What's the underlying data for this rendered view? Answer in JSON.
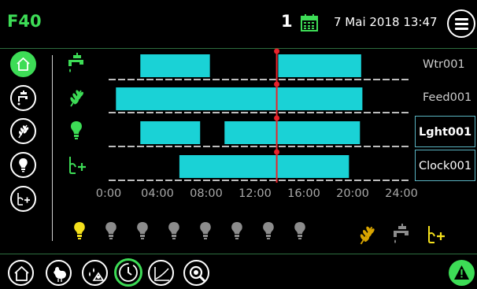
{
  "header": {
    "house_label": "F40",
    "day_number": "1",
    "date_time": "7 Mai 2018  13:47",
    "calendar_icon": "calendar-icon",
    "menu_icon": "hamburger-menu-icon"
  },
  "sidebar": {
    "items": [
      {
        "name": "home",
        "icon": "house-icon",
        "active": true
      },
      {
        "name": "water",
        "icon": "water-tap-icon",
        "active": false
      },
      {
        "name": "feed",
        "icon": "wheat-icon",
        "active": false
      },
      {
        "name": "light",
        "icon": "light-bulb-icon",
        "active": false
      },
      {
        "name": "clock",
        "icon": "clock-output-icon",
        "active": false
      }
    ]
  },
  "timeline": {
    "axis_ticks": [
      "0:00",
      "04:00",
      "08:00",
      "12:00",
      "16:00",
      "20:00",
      "24:00"
    ],
    "axis_hours": [
      0,
      4,
      8,
      12,
      16,
      20,
      24
    ],
    "current_time_hours": 13.78,
    "rows": [
      {
        "label": "Wtr001",
        "icon": "water-tap-icon",
        "icon_color": "#3ddc56",
        "boxed": false,
        "segments": [
          [
            2.6,
            8.3
          ],
          [
            13.9,
            20.7
          ]
        ]
      },
      {
        "label": "Feed001",
        "icon": "wheat-icon",
        "icon_color": "#3ddc56",
        "boxed": false,
        "segments": [
          [
            0.6,
            20.8
          ]
        ]
      },
      {
        "label": "Lght001",
        "icon": "light-bulb-icon",
        "icon_color": "#3ddc56",
        "boxed": true,
        "segments": [
          [
            2.6,
            7.5
          ],
          [
            9.5,
            20.6
          ]
        ]
      },
      {
        "label": "Clock001",
        "icon": "clock-output-icon",
        "icon_color": "#3ddc56",
        "boxed": true,
        "segments": [
          [
            5.8,
            19.7
          ]
        ]
      }
    ],
    "bar_color": "#1ad2d6",
    "marker_color": "#e8232a"
  },
  "outputs": {
    "bulbs": [
      {
        "icon": "light-bulb-icon",
        "on": true
      },
      {
        "icon": "light-bulb-icon",
        "on": false
      },
      {
        "icon": "light-bulb-icon",
        "on": false
      },
      {
        "icon": "light-bulb-icon",
        "on": false
      },
      {
        "icon": "light-bulb-icon",
        "on": false
      },
      {
        "icon": "light-bulb-icon",
        "on": false
      },
      {
        "icon": "light-bulb-icon",
        "on": false
      },
      {
        "icon": "light-bulb-icon",
        "on": false
      }
    ],
    "status_icons": [
      "wheat-icon",
      "water-tap-icon",
      "clock-output-icon"
    ]
  },
  "bottom_nav": {
    "items": [
      {
        "icon": "house-icon",
        "active": false
      },
      {
        "icon": "chicken-icon",
        "active": false
      },
      {
        "icon": "scale-drops-icon",
        "active": false
      },
      {
        "icon": "clock-icon",
        "active": true
      },
      {
        "icon": "graph-icon",
        "active": false
      },
      {
        "icon": "search-icon",
        "active": false
      }
    ],
    "alarm_icon": "alarm-warning-icon"
  },
  "colors": {
    "accent": "#3ddc56",
    "bulb_on": "#f4e01c",
    "bulb_off": "#8c8c8c",
    "background": "#000000"
  }
}
